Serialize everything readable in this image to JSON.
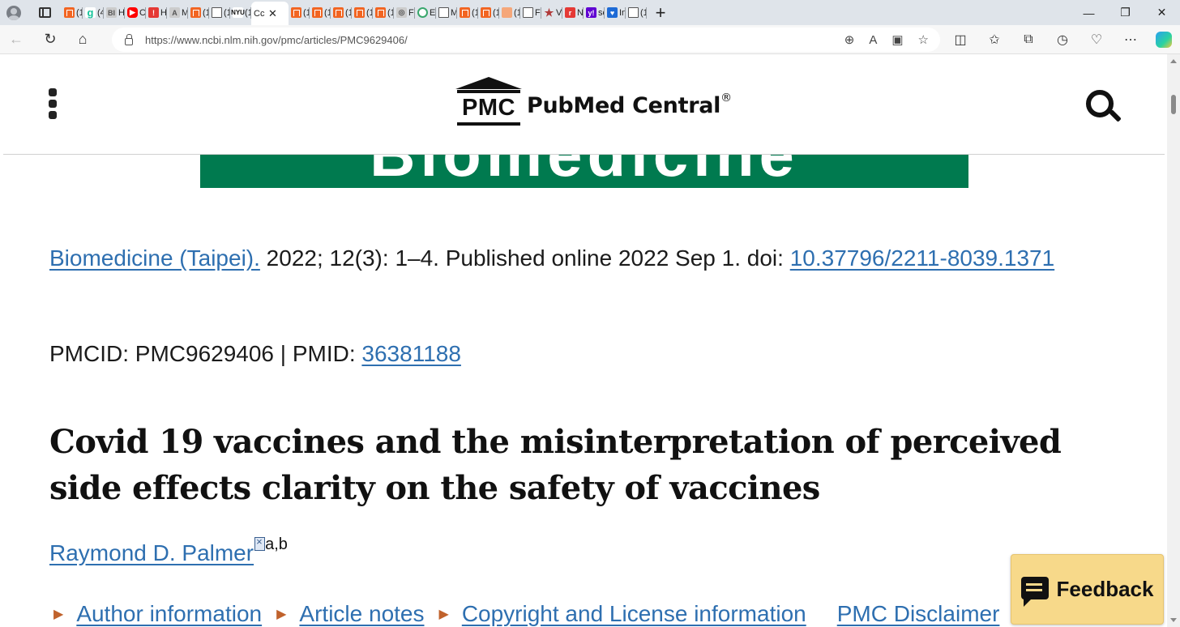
{
  "browser": {
    "tabs": [
      {
        "icon": "orange-bookmark-icon",
        "label": "(1("
      },
      {
        "icon": "grammarly-icon",
        "label": "(4."
      },
      {
        "icon": "bi-icon",
        "label": "Hc"
      },
      {
        "icon": "youtube-icon",
        "label": "Ca"
      },
      {
        "icon": "red-shield-icon",
        "label": "Hc"
      },
      {
        "icon": "ai-icon",
        "label": "M"
      },
      {
        "icon": "orange-bookmark-icon",
        "label": "(1("
      },
      {
        "icon": "document-icon",
        "label": "(1("
      },
      {
        "icon": "nyu-icon",
        "label": "(1("
      }
    ],
    "active_tab": {
      "label": "Cc",
      "close": "✕"
    },
    "tabs_after": [
      {
        "icon": "orange-bookmark-icon",
        "label": "(1("
      },
      {
        "icon": "orange-bookmark-icon",
        "label": "(1("
      },
      {
        "icon": "orange-bookmark-icon",
        "label": "(1("
      },
      {
        "icon": "orange-bookmark-icon",
        "label": "(1("
      },
      {
        "icon": "orange-bookmark-icon",
        "label": "(1("
      },
      {
        "icon": "globe-icon",
        "label": "Fa"
      },
      {
        "icon": "green-circle-icon",
        "label": "E8"
      },
      {
        "icon": "document-icon",
        "label": "M"
      },
      {
        "icon": "orange-bookmark-icon",
        "label": "(1("
      },
      {
        "icon": "orange-bookmark-icon",
        "label": "(1("
      },
      {
        "icon": "light-bookmark-icon",
        "label": "(1("
      },
      {
        "icon": "document-icon",
        "label": "FE"
      },
      {
        "icon": "star-icon",
        "label": "Vi"
      },
      {
        "icon": "red-square-icon",
        "label": "N"
      },
      {
        "icon": "yahoo-icon",
        "label": "sc"
      },
      {
        "icon": "shield-icon",
        "label": "In"
      },
      {
        "icon": "document-icon",
        "label": "(1("
      }
    ],
    "new_tab": "+",
    "window_controls": {
      "minimize": "—",
      "restore": "❐",
      "close": "✕"
    },
    "url": {
      "host": "https://www.ncbi.nlm.nih.gov",
      "path": "/pmc/articles/PMC9629406/"
    }
  },
  "pmc_header": {
    "logo_mark": "PMC",
    "logo_name": "PubMed Central",
    "logo_reg": "®"
  },
  "banner": {
    "text": "Biomedicine",
    "color": "#007a4f"
  },
  "citation": {
    "journal": "Biomedicine (Taipei).",
    "details": " 2022; 12(3): 1–4.  Published online 2022 Sep 1. doi: ",
    "doi": "10.37796/2211-8039.1371"
  },
  "ids": {
    "pmcid_label": "PMCID: PMC9629406 | PMID: ",
    "pmid": "36381188"
  },
  "article": {
    "title": "Covid 19 vaccines and the misinterpretation of perceived side effects clarity on the safety of vaccines",
    "author": "Raymond D. Palmer",
    "affiliations": "a,b"
  },
  "sections": {
    "author_info": "Author information",
    "article_notes": "Article notes",
    "copyright": "Copyright and License information",
    "disclaimer": "PMC Disclaimer"
  },
  "feedback": {
    "label": "Feedback"
  },
  "colors": {
    "link": "#2e6fb0",
    "accent_arrow": "#c0622c",
    "feedback_bg": "#f7d98a"
  }
}
